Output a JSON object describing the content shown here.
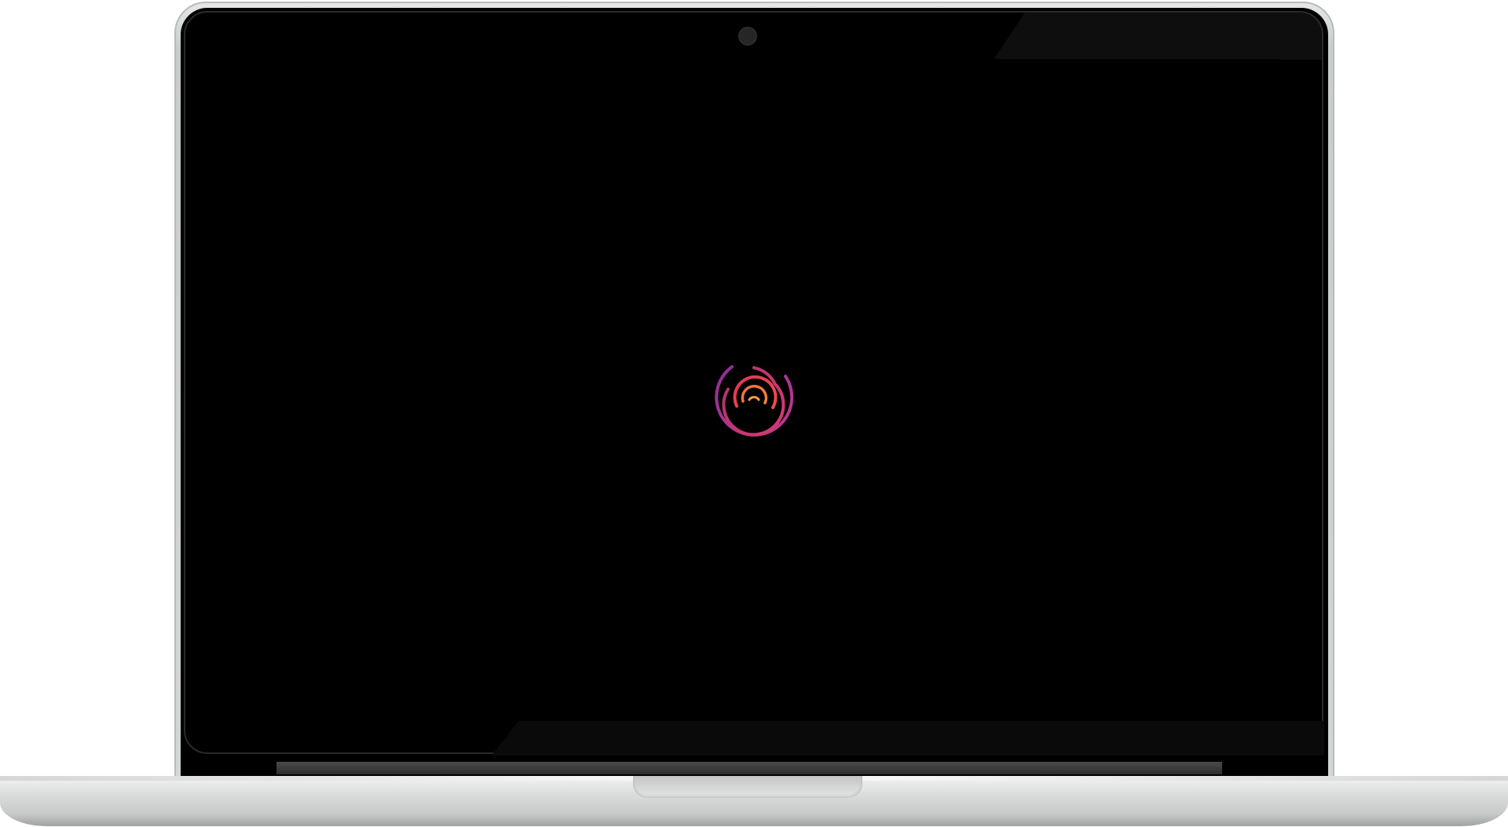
{
  "device": {
    "type": "laptop",
    "camera_icon": "camera-icon"
  },
  "screen": {
    "state": "loading",
    "background_color": "#000000",
    "logo": {
      "icon": "concentric-rings-logo-icon",
      "colors": [
        "#7b2d8e",
        "#b2306e",
        "#e2365a",
        "#f26d3d",
        "#f6a04a"
      ]
    }
  }
}
